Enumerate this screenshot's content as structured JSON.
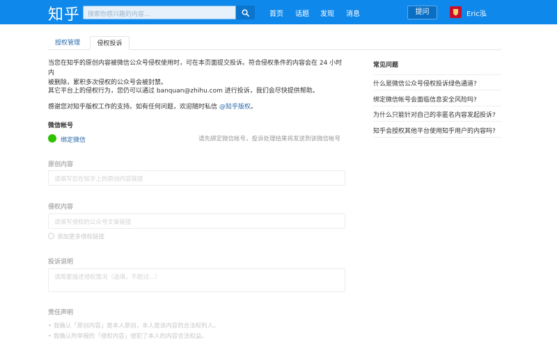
{
  "header": {
    "logo": "知乎",
    "search_placeholder": "搜索你感兴趣的内容...",
    "nav": [
      "首页",
      "话题",
      "发现",
      "消息"
    ],
    "ask_label": "提问",
    "username": "Eric泓",
    "colors": {
      "bar": "#0f88eb",
      "accent": "#0b74cc"
    }
  },
  "tabs": [
    {
      "label": "授权管理",
      "active": false
    },
    {
      "label": "侵权投诉",
      "active": true
    }
  ],
  "intro": {
    "p1_line1": "当您在知乎的原创内容被微信公众号侵权使用时，可在本页面提交投诉。符合侵权条件的内容会在 24 小时内",
    "p1_line2": "被删除，累积多次侵权的公众号会被封禁。",
    "p2": "其它平台上的侵权行为，您仍可以通过 banquan@zhihu.com 进行投诉，我们会尽快提供帮助。",
    "p3_text": "感谢您对知乎版权工作的支持。如有任何问题，欢迎随时私信 ",
    "p3_link": "@知乎版权",
    "p3_end": "。"
  },
  "wechat": {
    "label": "微信帐号",
    "bind_link": "绑定微信",
    "hint": "请先绑定微信帐号，投诉处理结果将发送到该微信帐号"
  },
  "form": {
    "original_label": "原创内容",
    "original_placeholder": "请填写您在知乎上的原创内容链接",
    "infringing_label": "侵权内容",
    "infringing_placeholder": "请填写侵权的公众号文章链接",
    "add_more": "添加更多侵权链接",
    "desc_label": "投诉说明",
    "desc_placeholder": "请简要描述侵权情况（选填，不超过...）",
    "declaration_label": "责任声明",
    "declaration_1": "• 我确认「原创内容」是本人原创，本人是该内容的合法权利人。",
    "declaration_2": "• 我确认所举报的「侵权内容」侵犯了本人的内容合法权益。"
  },
  "sidebar": {
    "title": "常见问题",
    "items": [
      "什么是微信公众号侵权投诉绿色通道?",
      "绑定微信帐号会面临信息安全风险吗?",
      "为什么只能针对自己的非匿名内容发起投诉?",
      "知乎会授权其他平台使用知乎用户的内容吗?"
    ]
  }
}
